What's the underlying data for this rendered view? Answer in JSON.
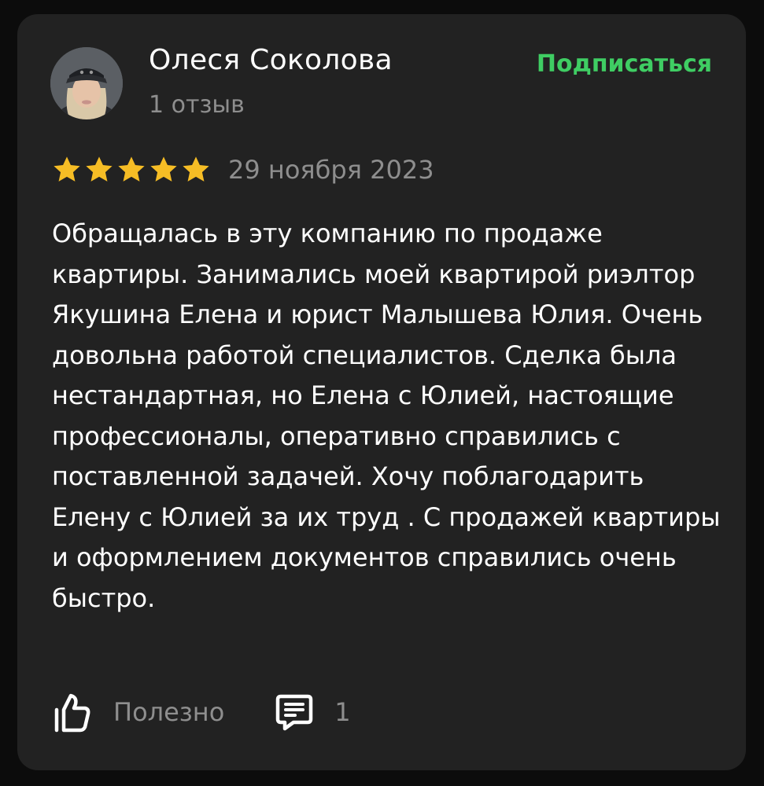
{
  "review": {
    "author": {
      "name": "Олеся Соколова",
      "review_count": "1 отзыв",
      "avatar_icon": "user-avatar-photo"
    },
    "subscribe_label": "Подписаться",
    "rating": 5,
    "rating_max": 5,
    "date": "29 ноября 2023",
    "text": "Обращалась в эту компанию по продаже квартиры. Занимались моей квартирой риэлтор Якушина Елена и юрист Малышева Юлия. Очень довольна работой специалистов. Сделка была нестандартная, но Елена с Юлией, настоящие профессионалы, оперативно справились с поставленной задачей. Хочу поблагодарить Елену с Юлией за их труд . С продажей квартиры и оформлением документов справились очень быстро.",
    "actions": {
      "useful_label": "Полезно",
      "useful_icon": "thumbs-up-icon",
      "comments_icon": "comment-icon",
      "comments_count": "1"
    }
  },
  "colors": {
    "background": "#0c0c0c",
    "card": "#222222",
    "accent_green": "#3fcd63",
    "star": "#f6bd25",
    "text_primary": "#ffffff",
    "text_secondary": "#8e8e8e"
  }
}
